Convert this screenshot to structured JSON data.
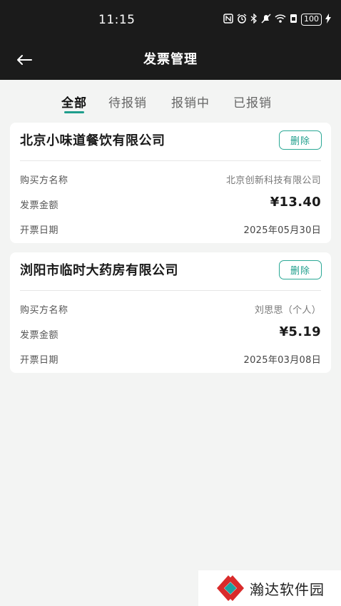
{
  "status_bar": {
    "time": "11:15",
    "battery": "100"
  },
  "header": {
    "title": "发票管理"
  },
  "tabs": [
    {
      "label": "全部",
      "active": true
    },
    {
      "label": "待报销",
      "active": false
    },
    {
      "label": "报销中",
      "active": false
    },
    {
      "label": "已报销",
      "active": false
    }
  ],
  "invoices": [
    {
      "title": "北京小味道餐饮有限公司",
      "delete_label": "删除",
      "buyer_label": "购买方名称",
      "buyer_value": "北京创新科技有限公司",
      "amount_label": "发票金额",
      "amount_value": "¥13.40",
      "date_label": "开票日期",
      "date_value": "2025年05月30日"
    },
    {
      "title": "浏阳市临时大药房有限公司",
      "delete_label": "删除",
      "buyer_label": "购买方名称",
      "buyer_value": "刘思思（个人）",
      "amount_label": "发票金额",
      "amount_value": "¥5.19",
      "date_label": "开票日期",
      "date_value": "2025年03月08日"
    }
  ],
  "watermark": {
    "text": "瀚达软件园"
  },
  "colors": {
    "accent": "#1f9e8c",
    "header_bg": "#1b1b1b",
    "page_bg": "#f3f4f3"
  }
}
